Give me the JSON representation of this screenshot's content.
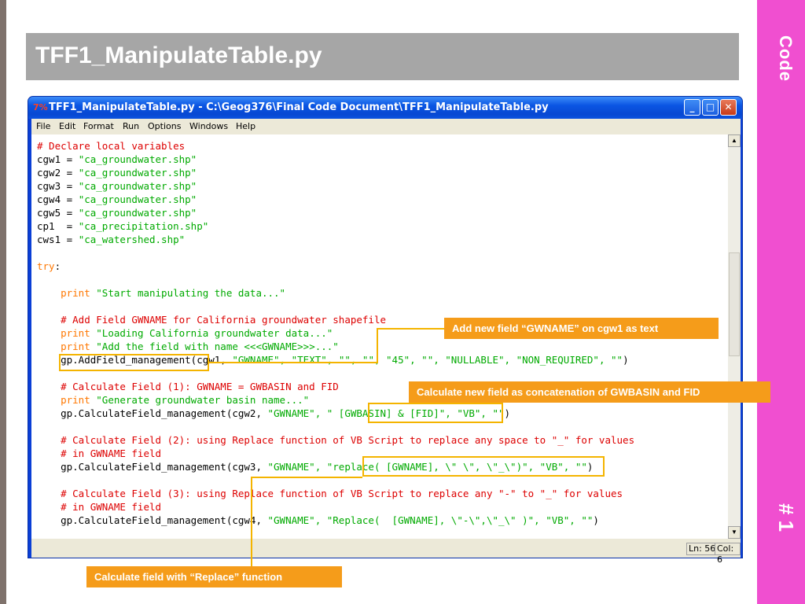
{
  "slide": {
    "title": "TFF1_ManipulateTable.py",
    "side_label": "Code",
    "slide_number": "# 1"
  },
  "window": {
    "title": "TFF1_ManipulateTable.py - C:\\Geog376\\Final Code Document\\TFF1_ManipulateTable.py",
    "app_icon": "python-idle-icon",
    "controls": {
      "minimize": "_",
      "maximize": "□",
      "close": "✕"
    },
    "menu": [
      "File",
      "Edit",
      "Format",
      "Run",
      "Options",
      "Windows",
      "Help"
    ],
    "status": {
      "line": "Ln: 56",
      "col": "Col: 6"
    }
  },
  "code": {
    "line1": "# Declare local variables",
    "line2_var": "cgw1 = ",
    "line2_str": "\"ca_groundwater.shp\"",
    "line3_var": "cgw2 = ",
    "line3_str": "\"ca_groundwater.shp\"",
    "line4_var": "cgw3 = ",
    "line4_str": "\"ca_groundwater.shp\"",
    "line5_var": "cgw4 = ",
    "line5_str": "\"ca_groundwater.shp\"",
    "line6_var": "cgw5 = ",
    "line6_str": "\"ca_groundwater.shp\"",
    "line7_var": "cp1  = ",
    "line7_str": "\"ca_precipitation.shp\"",
    "line8_var": "cws1 = ",
    "line8_str": "\"ca_watershed.shp\"",
    "line10_kw": "try",
    "line10_rest": ":",
    "line12_kw": "    print ",
    "line12_str": "\"Start manipulating the data...\"",
    "line14": "    # Add Field GWNAME for California groundwater shapefile",
    "line15_kw": "    print ",
    "line15_str": "\"Loading California groundwater data...\"",
    "line16_kw": "    print ",
    "line16_str": "\"Add the field with name <<<GWNAME>>>...\"",
    "line17_a": "    gp.AddField_management(cgw1, ",
    "line17_b": "\"GWNAME\", \"TEXT\", \"\", \"\", \"45\", \"\", \"NULLABLE\", \"NON_REQUIRED\", \"\"",
    "line17_c": ")",
    "line19": "    # Calculate Field (1): GWNAME = GWBASIN and FID",
    "line20_kw": "    print ",
    "line20_str": "\"Generate groundwater basin name...\"",
    "line21_a": "    gp.CalculateField_management(cgw2, ",
    "line21_b": "\"GWNAME\", \" [GWBASIN] & [FID]\", \"VB\", \"\"",
    "line21_c": ")",
    "line23": "    # Calculate Field (2): using Replace function of VB Script to replace any space to \"_\" for values",
    "line24": "    # in GWNAME field",
    "line25_a": "    gp.CalculateField_management(cgw3, ",
    "line25_b": "\"GWNAME\", \"replace( [GWNAME], \\\" \\\", \\\"_\\\")\", \"VB\", \"\"",
    "line25_c": ")",
    "line27": "    # Calculate Field (3): using Replace function of VB Script to replace any \"-\" to \"_\" for values",
    "line28": "    # in GWNAME field",
    "line29_a": "    gp.CalculateField_management(cgw4, ",
    "line29_b": "\"GWNAME\", \"Replace(  [GWNAME], \\\"-\\\",\\\"_\\\" )\", \"VB\", \"\"",
    "line29_c": ")"
  },
  "callouts": {
    "add_field": "Add new field “GWNAME” on cgw1 as text",
    "concat": "Calculate new field as concatenation of GWBASIN and FID",
    "replace": "Calculate field with “Replace” function"
  },
  "colors": {
    "accent_band": "#f04fd0",
    "title_bar": "#a6a6a6",
    "callout": "#f59c1a",
    "highlight": "#f4b400"
  }
}
